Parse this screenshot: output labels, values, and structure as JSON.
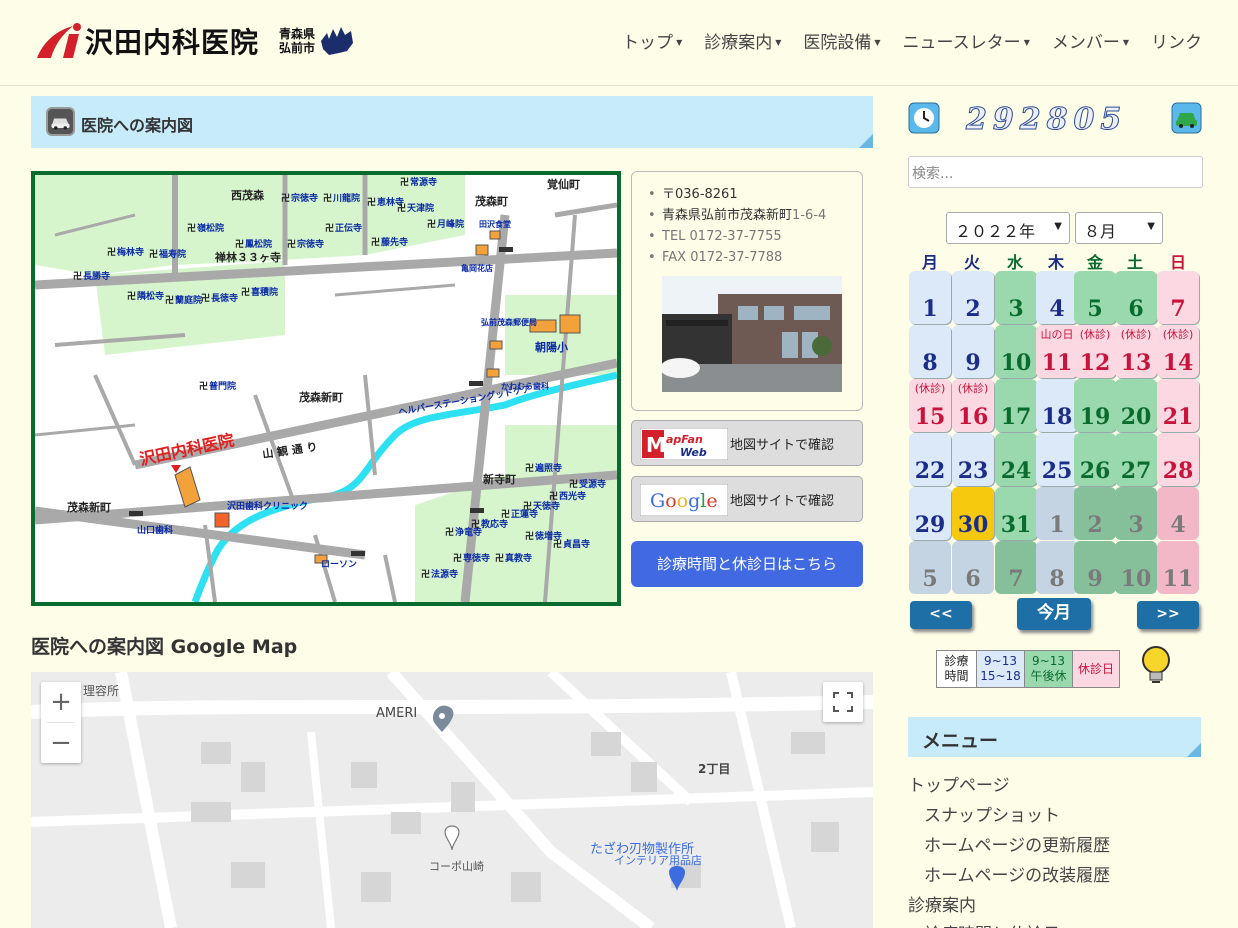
{
  "header": {
    "logo_title": "沢田内科医院",
    "logo_sub1": "青森県",
    "logo_sub2": "弘前市",
    "nav": [
      "トップ",
      "診療案内",
      "医院設備",
      "ニュースレター",
      "メンバー",
      "リンク"
    ]
  },
  "section": {
    "title": "医院への案内図"
  },
  "static_map": {
    "labels": {
      "nishi_moriya": "西茂森",
      "shigemori_cho": "茂森町",
      "kakusen_cho": "覚仙町",
      "shigemori_shinmachi": "茂森新町",
      "shigemori_shinmachi2": "茂森新町",
      "shinteramachi": "新寺町",
      "sanjusanka": "禅林３３ヶ寺",
      "clinic": "沢田内科医院",
      "sankan": "山 観 通 り",
      "chouyou": "朝陽小",
      "helper": "ヘルパーステーショングッドケア",
      "sawada_dental": "沢田歯科クリニック",
      "yamaguchi_dental": "山口歯科",
      "lawson": "ローソン",
      "post": "弘前茂森郵便局",
      "kamei": "亀岡花店",
      "tazawa": "田沢食堂",
      "kawamura": "かわむら歯科"
    },
    "temples": [
      "常源寺",
      "宗徳寺",
      "川龍院",
      "恵林寺",
      "天津院",
      "正伝寺",
      "月峰院",
      "梅林寺",
      "嶺松院",
      "福寿院",
      "鳳松院",
      "宗徳寺",
      "藤先寺",
      "長勝寺",
      "隣松寺",
      "蘭庭院",
      "長徳寺",
      "喜積院",
      "普門院",
      "遍照寺",
      "受源寺",
      "天徳寺",
      "西光寺",
      "正蓮寺",
      "浄竜寺",
      "教応寺",
      "徳増寺",
      "貞昌寺",
      "専徳寺",
      "真教寺",
      "法源寺"
    ]
  },
  "address": {
    "postal": "〒036-8261",
    "address_main": "青森県弘前市茂森新町",
    "address_num": "1-6-4",
    "tel": "TEL 0172-37-7755",
    "fax": "FAX 0172-37-7788"
  },
  "buttons": {
    "mapfan_label": "地図サイトで確認",
    "google_label": "地図サイトで確認",
    "mapfan_badge": "MapFan Web",
    "google_badge": "Google",
    "hours_label": "診療時間と休診日はこちら"
  },
  "gmap": {
    "title": "医院への案内図 Google Map",
    "labels": [
      "理容所",
      "AMERI",
      "2丁目",
      "コーポ山崎",
      "たざわ刃物製作所",
      "インテリア用品店"
    ]
  },
  "counter": {
    "value": "292805"
  },
  "search": {
    "placeholder": "検索..."
  },
  "calendar": {
    "year_label": "２０２２年",
    "month_label": "８月",
    "weekdays": [
      "月",
      "火",
      "水",
      "木",
      "金",
      "土",
      "日"
    ],
    "weekday_colors": [
      "#1b2d8a",
      "#1b2d8a",
      "#0a6b2f",
      "#1b2d8a",
      "#0a6b2f",
      "#0a6b2f",
      "#c8143c"
    ],
    "weeks": [
      [
        {
          "d": "1",
          "t": "n"
        },
        {
          "d": "2",
          "t": "n"
        },
        {
          "d": "3",
          "t": "h"
        },
        {
          "d": "4",
          "t": "n"
        },
        {
          "d": "5",
          "t": "h"
        },
        {
          "d": "6",
          "t": "h"
        },
        {
          "d": "7",
          "t": "c"
        }
      ],
      [
        {
          "d": "8",
          "t": "n"
        },
        {
          "d": "9",
          "t": "n"
        },
        {
          "d": "10",
          "t": "h"
        },
        {
          "d": "11",
          "t": "c",
          "note": "山の日"
        },
        {
          "d": "12",
          "t": "c",
          "note": "(休診)"
        },
        {
          "d": "13",
          "t": "c",
          "note": "(休診)"
        },
        {
          "d": "14",
          "t": "c",
          "note": "(休診)"
        }
      ],
      [
        {
          "d": "15",
          "t": "c",
          "note": "(休診)"
        },
        {
          "d": "16",
          "t": "c",
          "note": "(休診)"
        },
        {
          "d": "17",
          "t": "h"
        },
        {
          "d": "18",
          "t": "n"
        },
        {
          "d": "19",
          "t": "h"
        },
        {
          "d": "20",
          "t": "h"
        },
        {
          "d": "21",
          "t": "c"
        }
      ],
      [
        {
          "d": "22",
          "t": "n"
        },
        {
          "d": "23",
          "t": "n"
        },
        {
          "d": "24",
          "t": "h"
        },
        {
          "d": "25",
          "t": "n"
        },
        {
          "d": "26",
          "t": "h"
        },
        {
          "d": "27",
          "t": "h"
        },
        {
          "d": "28",
          "t": "c"
        }
      ],
      [
        {
          "d": "29",
          "t": "n"
        },
        {
          "d": "30",
          "t": "today"
        },
        {
          "d": "31",
          "t": "h"
        },
        {
          "d": "1",
          "t": "on"
        },
        {
          "d": "2",
          "t": "oh"
        },
        {
          "d": "3",
          "t": "oh"
        },
        {
          "d": "4",
          "t": "oc"
        }
      ],
      [
        {
          "d": "5",
          "t": "on"
        },
        {
          "d": "6",
          "t": "on"
        },
        {
          "d": "7",
          "t": "oh"
        },
        {
          "d": "8",
          "t": "on"
        },
        {
          "d": "9",
          "t": "oh"
        },
        {
          "d": "10",
          "t": "oh"
        },
        {
          "d": "11",
          "t": "oc"
        }
      ]
    ],
    "prev_label": "<<",
    "today_label": "今月",
    "next_label": ">>",
    "legend": {
      "title": "診療時間",
      "full": "9~13 15~18",
      "half": "9~13 午後休",
      "closed": "休診日"
    }
  },
  "menu": {
    "title": "メニュー",
    "items": [
      "トップページ",
      "スナップショット",
      "ホームページの更新履歴",
      "ホームページの改装履歴",
      "診療案内",
      "診療時間と休診日"
    ]
  },
  "colors": {
    "normal_bg": "#dbe9f9",
    "half_bg": "#9ad9ad",
    "closed_bg": "#fbd8e2",
    "today_bg": "#f6c90e"
  }
}
